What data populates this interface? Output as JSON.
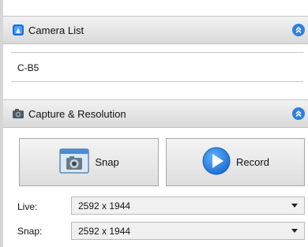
{
  "camera_panel": {
    "title": "Camera List",
    "icon": "camera-list-icon",
    "items": [
      "C-B5"
    ]
  },
  "capture_panel": {
    "title": "Capture & Resolution",
    "icon": "camera-icon",
    "snap_label": "Snap",
    "record_label": "Record",
    "live": {
      "label": "Live:",
      "value": "2592 x 1944"
    },
    "snap": {
      "label": "Snap:",
      "value": "2592 x 1944"
    }
  },
  "colors": {
    "accent": "#2b7fe0",
    "header_bg": "#e3e3e3"
  }
}
